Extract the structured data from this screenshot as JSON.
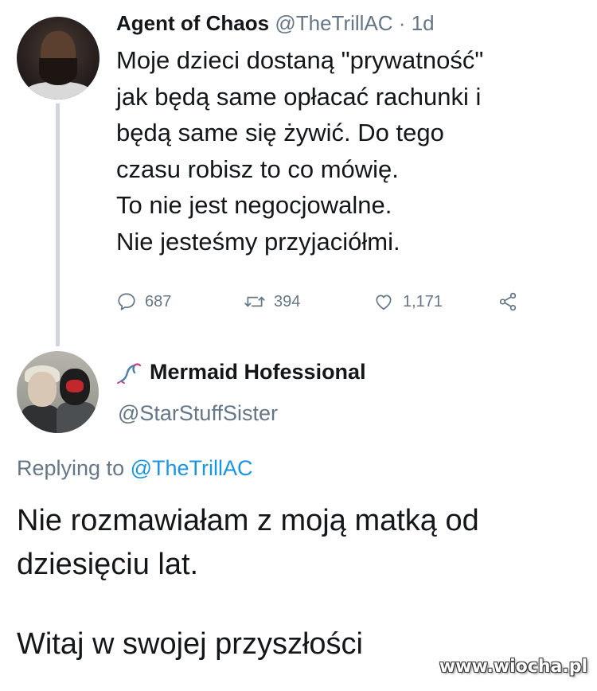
{
  "tweet1": {
    "author_name": "Agent of Chaos",
    "handle": "@TheTrillAC",
    "separator": "·",
    "time": "1d",
    "lines": [
      "Moje dzieci dostaną \"prywatność\"",
      "jak będą same opłacać rachunki i",
      "będą same się żywić. Do tego",
      "czasu robisz to co mówię.",
      "To nie jest negocjowalne.",
      "Nie jesteśmy przyjaciółmi."
    ],
    "reply_count": "687",
    "retweet_count": "394",
    "like_count": "1,171",
    "icons": {
      "reply": "reply-icon",
      "retweet": "retweet-icon",
      "like": "heart-icon",
      "share": "share-icon"
    }
  },
  "tweet2": {
    "author_name": "Mermaid Hofessional",
    "name_emoji": "mermaid-tail-icon",
    "handle": "@StarStuffSister",
    "replying_prefix": "Replying to",
    "replying_handle": "@TheTrillAC",
    "lines": [
      "Nie rozmawiałam z moją matką od",
      "dziesięciu lat."
    ],
    "closing_line": "Witaj w swojej przyszłości"
  },
  "watermark": "www.wiocha.pl",
  "colors": {
    "text": "#14171a",
    "muted": "#657786",
    "link": "#1b95e0",
    "thread_line": "#cfd5da"
  }
}
